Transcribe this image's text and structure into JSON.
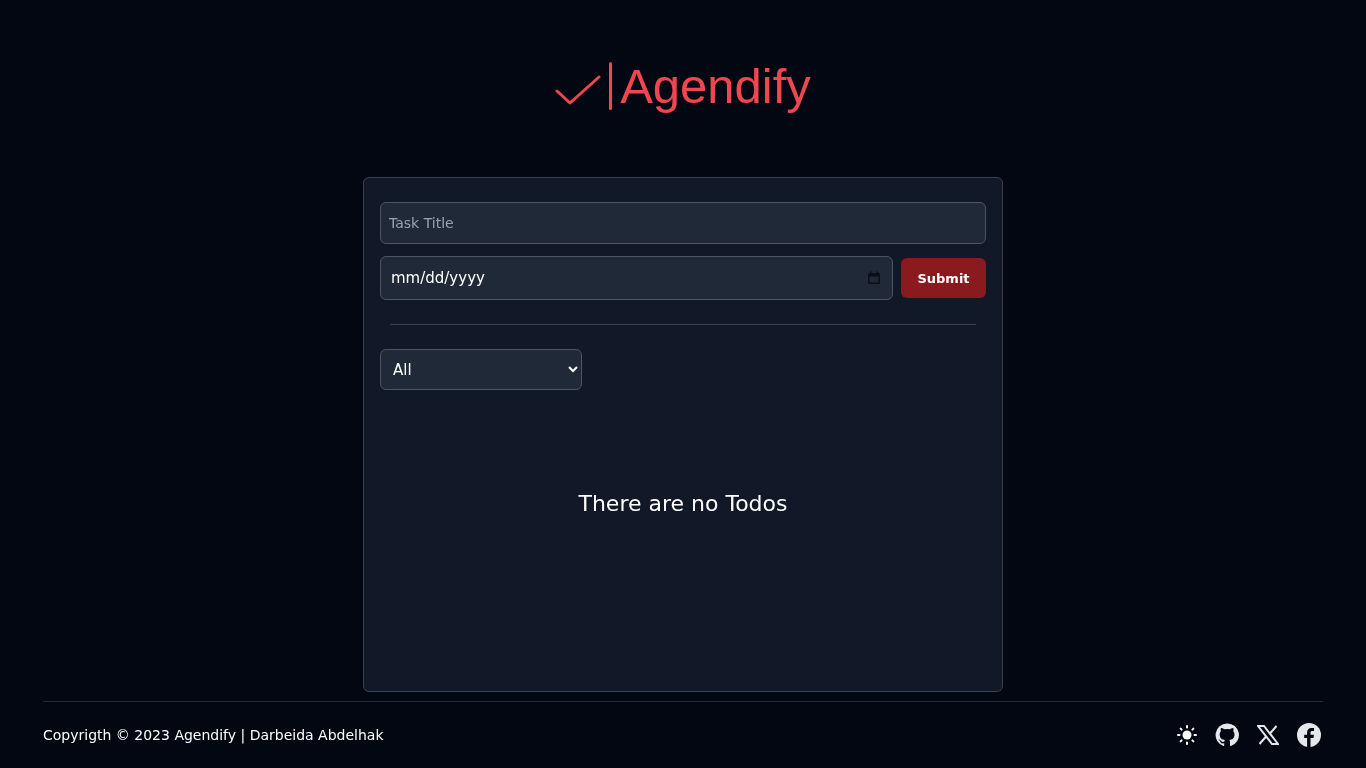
{
  "logo": {
    "text": "Agendify"
  },
  "form": {
    "title_placeholder": "Task Title",
    "date_placeholder": "mm/dd/yyyy",
    "submit": "Submit"
  },
  "filter": {
    "value": "All"
  },
  "empty_message": "There are no Todos",
  "footer": {
    "copyright": "Copyrigth © 2023 Agendify | Darbeida Abdelhak"
  }
}
